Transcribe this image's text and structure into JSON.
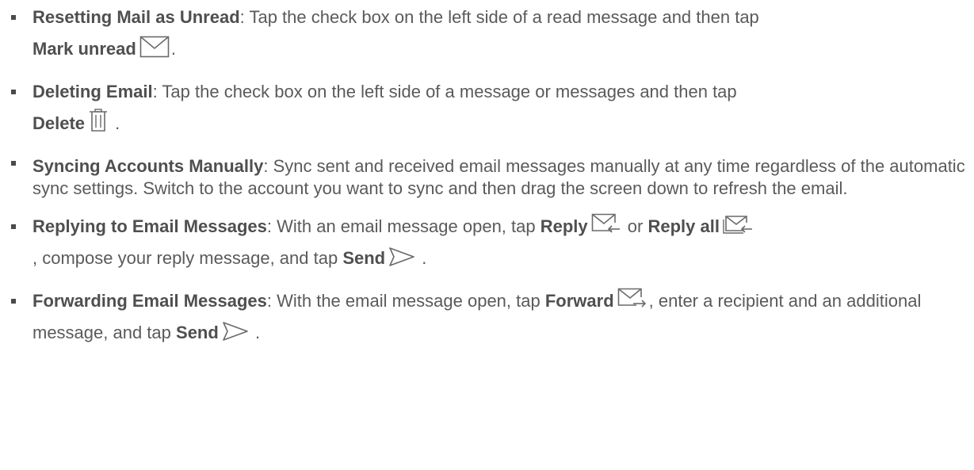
{
  "items": [
    {
      "term": "Resetting Mail as Unread",
      "text": ": Tap the check box on the left side of a read message and then tap ",
      "button": "Mark unread",
      "icon": "envelope-icon",
      "end": "."
    },
    {
      "term": "Deleting Email",
      "text": ": Tap the check box on the left side of a message or messages and then tap ",
      "button": "Delete",
      "icon": "trash-icon",
      "end": "."
    },
    {
      "term": "Syncing Accounts Manually",
      "text": ": Sync sent and received email messages manually at any time regardless of the automatic sync settings. Switch to the account you want to sync and then drag the screen down to refresh the email."
    },
    {
      "term": "Replying to Email Messages",
      "text1": ": With an email message open, tap ",
      "button1": "Reply",
      "icon1": "reply-icon",
      "text2": " or ",
      "button2": "Reply all",
      "icon2": "reply-all-icon",
      "text3": ", compose your reply message, and tap ",
      "button3": "Send",
      "icon3": "send-icon",
      "end": "."
    },
    {
      "term": "Forwarding Email Messages",
      "text1": ": With the email message open, tap ",
      "button1": "Forward",
      "icon1": "forward-icon",
      "text2": ", enter a recipient and an additional message, and tap ",
      "button2": "Send",
      "icon2": "send-icon",
      "end": "."
    }
  ]
}
